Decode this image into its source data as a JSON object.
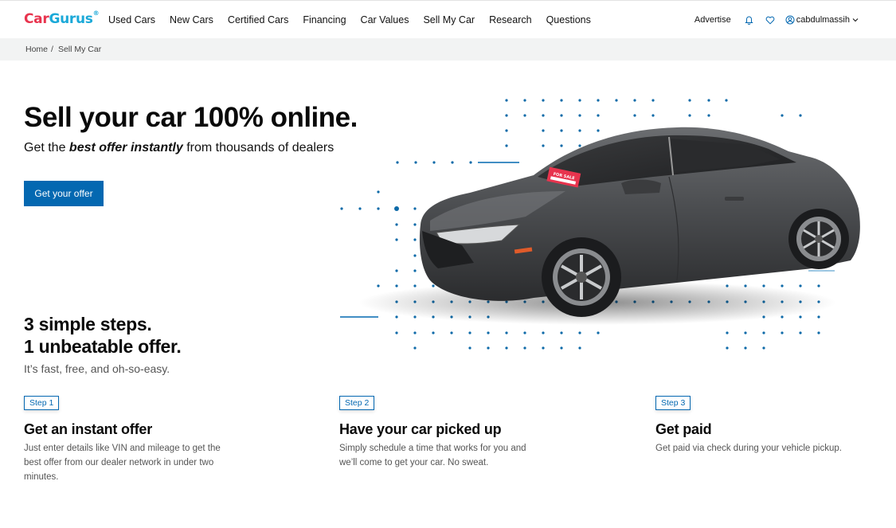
{
  "header": {
    "logo": {
      "part1": "Car",
      "part2": "Gurus",
      "mark": "®"
    },
    "nav": [
      "Used Cars",
      "New Cars",
      "Certified Cars",
      "Financing",
      "Car Values",
      "Sell My Car",
      "Research",
      "Questions"
    ],
    "advertise": "Advertise",
    "icons": {
      "notifications": "bell-icon",
      "favorites": "heart-icon",
      "account": "user-circle-icon",
      "menu": "chevron-down-icon"
    },
    "username": "cabdulmassih"
  },
  "breadcrumb": {
    "items": [
      "Home",
      "Sell My Car"
    ],
    "separator": "/"
  },
  "hero": {
    "title": "Sell your car 100% online.",
    "subtitle_prefix": "Get the ",
    "subtitle_emphasis": "best offer instantly",
    "subtitle_suffix": " from thousands of dealers",
    "cta": "Get your offer",
    "image_alt": "Gray coupe with For Sale sign",
    "sign_text": "FOR SALE"
  },
  "steps_section": {
    "heading_line1": "3 simple steps.",
    "heading_line2": "1 unbeatable offer.",
    "subheading": "It’s fast, free, and oh-so-easy.",
    "steps": [
      {
        "badge": "Step 1",
        "title": "Get an instant offer",
        "description": "Just enter details like VIN and mileage to get the best offer from our dealer network in under two minutes."
      },
      {
        "badge": "Step 2",
        "title": "Have your car picked up",
        "description": "Simply schedule a time that works for you and we’ll come to get your car. No sweat."
      },
      {
        "badge": "Step 3",
        "title": "Get paid",
        "description": "Get paid via check during your vehicle pickup."
      }
    ]
  },
  "colors": {
    "brand_red": "#e8344e",
    "brand_blue": "#1ba9d8",
    "primary": "#0468b1",
    "breadcrumb_bg": "#f2f3f3"
  }
}
